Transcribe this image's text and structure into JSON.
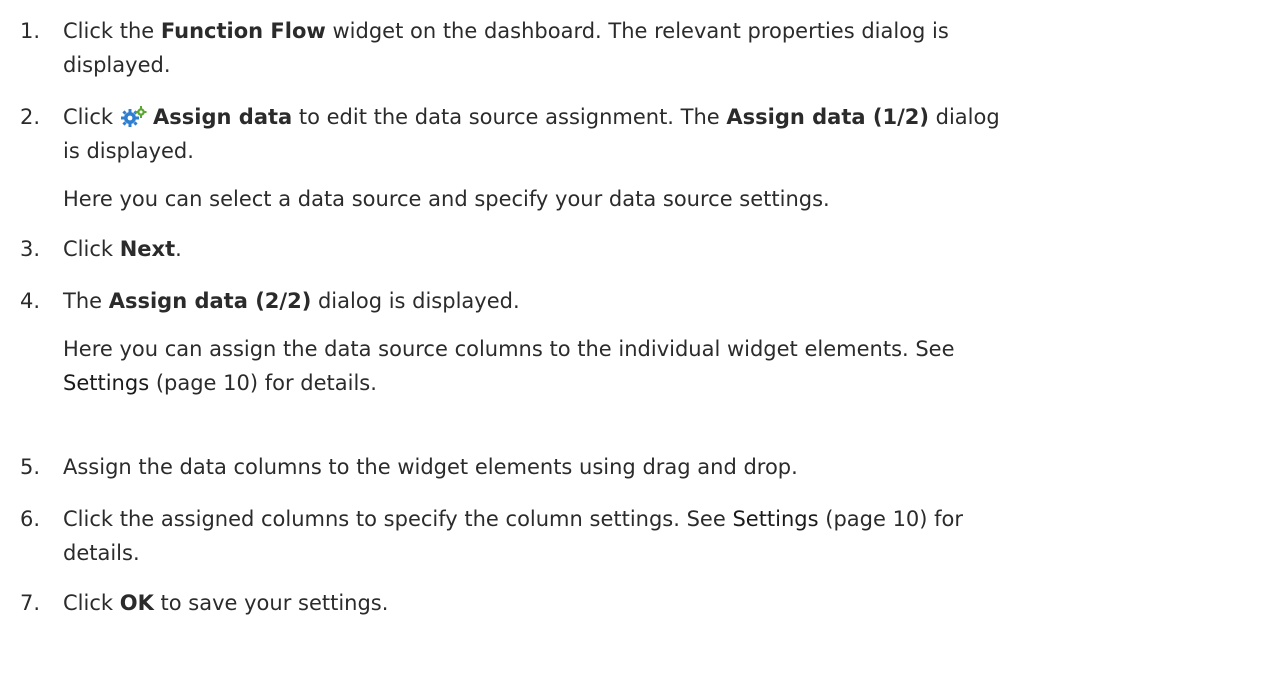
{
  "steps": [
    {
      "num": "1.",
      "line1": {
        "pre": "Click the ",
        "bold": "Function Flow",
        "post": " widget on the dashboard. The relevant properties dialog is"
      },
      "line2": "displayed."
    },
    {
      "num": "2.",
      "icon": "gears-icon",
      "line1": {
        "pre": "Click",
        "bold1": "Assign data",
        "mid": " to edit the data source assignment. The ",
        "bold2": "Assign data (1/2)",
        "post": " dialog"
      },
      "line2": "is displayed.",
      "sub": "Here you can select a data source and specify your data source settings."
    },
    {
      "num": "3.",
      "pre": "Click ",
      "bold": "Next",
      "post": "."
    },
    {
      "num": "4.",
      "pre": "The ",
      "bold": "Assign data (2/2)",
      "post": " dialog is displayed.",
      "sub1": "Here you can assign the data source columns to the individual widget elements. See",
      "sub2_link": "Settings",
      "sub2_post": " (page 10) for details."
    },
    {
      "num": "5.",
      "text": "Assign the data columns to the widget elements using drag and drop."
    },
    {
      "num": "6.",
      "line1_pre": "Click the assigned columns to specify the column settings. See ",
      "line1_link": "Settings",
      "line1_post": " (page 10) for",
      "line2": "details."
    },
    {
      "num": "7.",
      "pre": "Click ",
      "bold": "OK",
      "post": " to save your settings."
    }
  ],
  "colors": {
    "text": "#2b2b2b",
    "icon_blue": "#2f7fd0",
    "icon_green": "#5aa832"
  }
}
